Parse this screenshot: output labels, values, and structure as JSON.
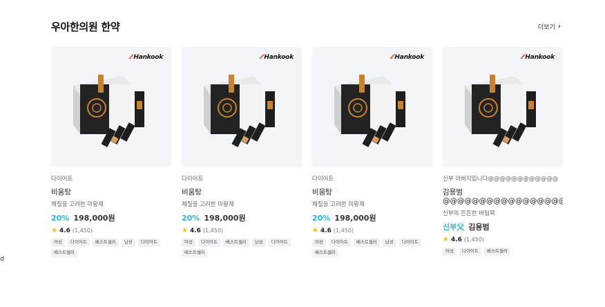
{
  "section": {
    "title": "우아한의원 한약",
    "more_label": "더보기"
  },
  "stray_text": "d",
  "brand_logo": "Hankook",
  "cards": [
    {
      "category": "다이어트",
      "name": "비움탕",
      "name_line2": "",
      "description": "체질을 고려한 미황제",
      "discount": "20%",
      "price": "198,000원",
      "brand_title": "",
      "rating": "4.6",
      "review_count": "(1,450)",
      "tags": [
        "여성",
        "다이어트",
        "베스트셀러",
        "남성",
        "다이어트",
        "베스트셀러"
      ]
    },
    {
      "category": "다이어트",
      "name": "비움탕",
      "name_line2": "",
      "description": "체질을 고려한 미황제",
      "discount": "20%",
      "price": "198,000원",
      "brand_title": "",
      "rating": "4.6",
      "review_count": "(1,450)",
      "tags": [
        "여성",
        "다이어트",
        "베스트셀러",
        "남성",
        "다이어트",
        "베스트셀러"
      ]
    },
    {
      "category": "다이어트",
      "name": "비움탕",
      "name_line2": "",
      "description": "체질을 고려한 미황제",
      "discount": "20%",
      "price": "198,000원",
      "brand_title": "",
      "rating": "4.6",
      "review_count": "(1,450)",
      "tags": [
        "여성",
        "다이어트",
        "베스트셀러",
        "남성",
        "다이어트",
        "베스트셀러"
      ]
    },
    {
      "category": "신부 아버지입니다@@@@@@@@@@@@",
      "name": "김용범",
      "name_line2": "@@@@@@@@@@@@@@@@@@@@@@",
      "description": "신부의 든든한 버팀목",
      "discount": "",
      "price": "",
      "brand_title": "신부父",
      "brand_person": "김용범",
      "rating": "4.6",
      "review_count": "(1,450)",
      "tags": [
        "여성",
        "다이어트",
        "베스트셀러"
      ]
    }
  ]
}
